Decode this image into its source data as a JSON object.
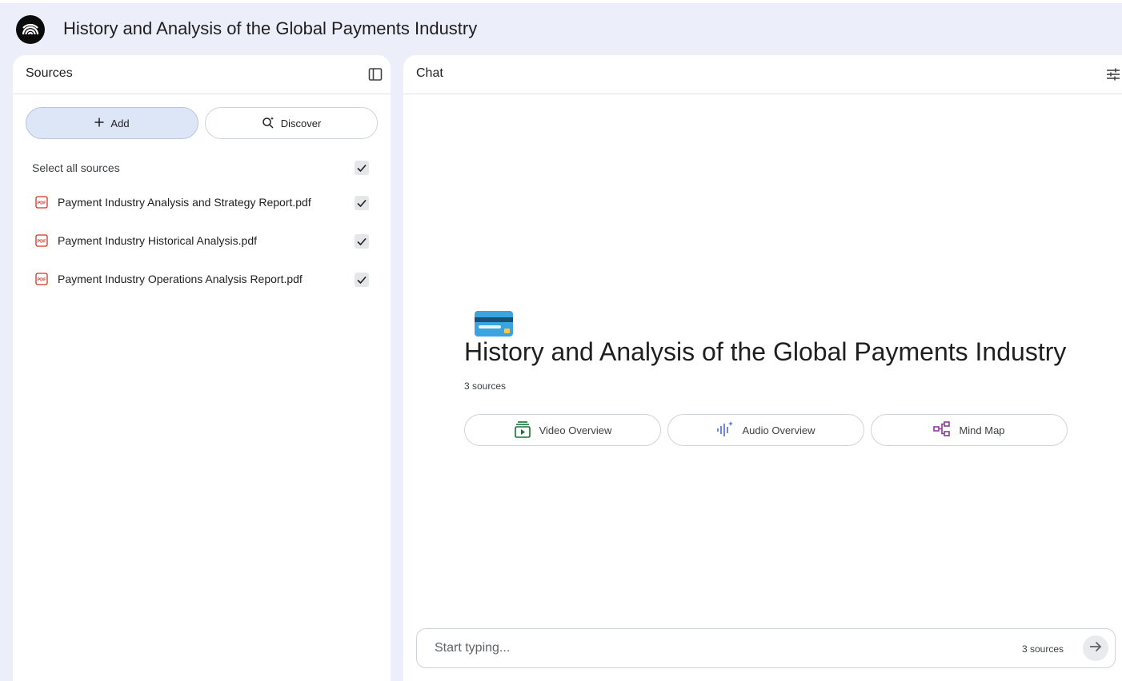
{
  "header": {
    "title": "History and Analysis of the Global Payments Industry",
    "logo_icon": "notebook-logo-icon"
  },
  "sources_panel": {
    "title": "Sources",
    "add_label": "Add",
    "discover_label": "Discover",
    "select_all_label": "Select all sources",
    "select_all_checked": true,
    "items": [
      {
        "name": "Payment Industry Analysis and Strategy Report.pdf",
        "icon": "pdf-icon",
        "checked": true
      },
      {
        "name": "Payment Industry Historical Analysis.pdf",
        "icon": "pdf-icon",
        "checked": true
      },
      {
        "name": "Payment Industry Operations Analysis Report.pdf",
        "icon": "pdf-icon",
        "checked": true
      }
    ]
  },
  "chat_panel": {
    "title": "Chat",
    "notebook_emoji": "credit-card-emoji",
    "notebook_title": "History and Analysis of the Global Payments Industry",
    "source_count": "3 sources",
    "overview_buttons": [
      {
        "label": "Video Overview",
        "icon": "video-overview-icon",
        "color": "#137333"
      },
      {
        "label": "Audio Overview",
        "icon": "audio-overview-icon",
        "color": "#4b6bd6"
      },
      {
        "label": "Mind Map",
        "icon": "mind-map-icon",
        "color": "#8e3a9d"
      }
    ],
    "composer": {
      "placeholder": "Start typing...",
      "source_count": "3 sources"
    }
  },
  "colors": {
    "background": "#eceffa",
    "add_button_bg": "#dde6f6",
    "panel_bg": "#ffffff"
  }
}
